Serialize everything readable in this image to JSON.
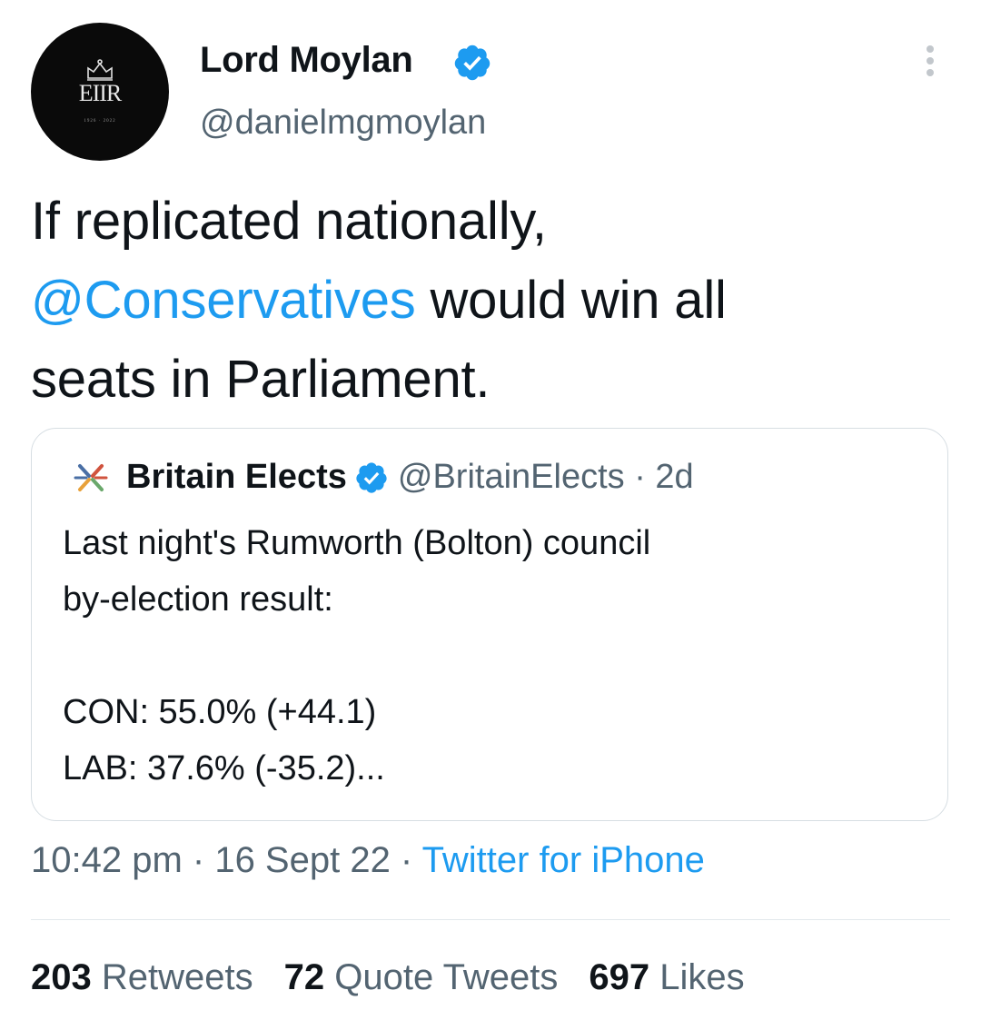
{
  "author": {
    "name": "Lord Moylan",
    "handle": "@danielmgmoylan",
    "avatar_cypher": "EIIR",
    "avatar_dates": "1926 · 2022"
  },
  "tweet": {
    "line1": "If replicated nationally,",
    "mention": "@Conservatives",
    "line2_rest": " would win all",
    "line3": "seats in Parliament."
  },
  "quote": {
    "name": "Britain Elects",
    "handle_time": "@BritainElects · 2d",
    "lines": [
      "Last night's Rumworth (Bolton) council",
      "by-election result:",
      "",
      "CON: 55.0% (+44.1)",
      "LAB: 37.6% (-35.2)..."
    ]
  },
  "meta": {
    "time_date": "10:42 pm · 16 Sept 22 · ",
    "source": "Twitter for iPhone"
  },
  "stats": {
    "retweets_count": "203",
    "retweets_label": "Retweets",
    "quotes_count": "72",
    "quotes_label": "Quote Tweets",
    "likes_count": "697",
    "likes_label": "Likes"
  },
  "icons": {
    "verified": "verified-badge-icon",
    "more": "more-vertical-icon",
    "quote_logo": "britain-elects-logo-icon"
  },
  "colors": {
    "accent": "#1d9bf0",
    "text": "#0f1419",
    "secondary": "#536471"
  }
}
